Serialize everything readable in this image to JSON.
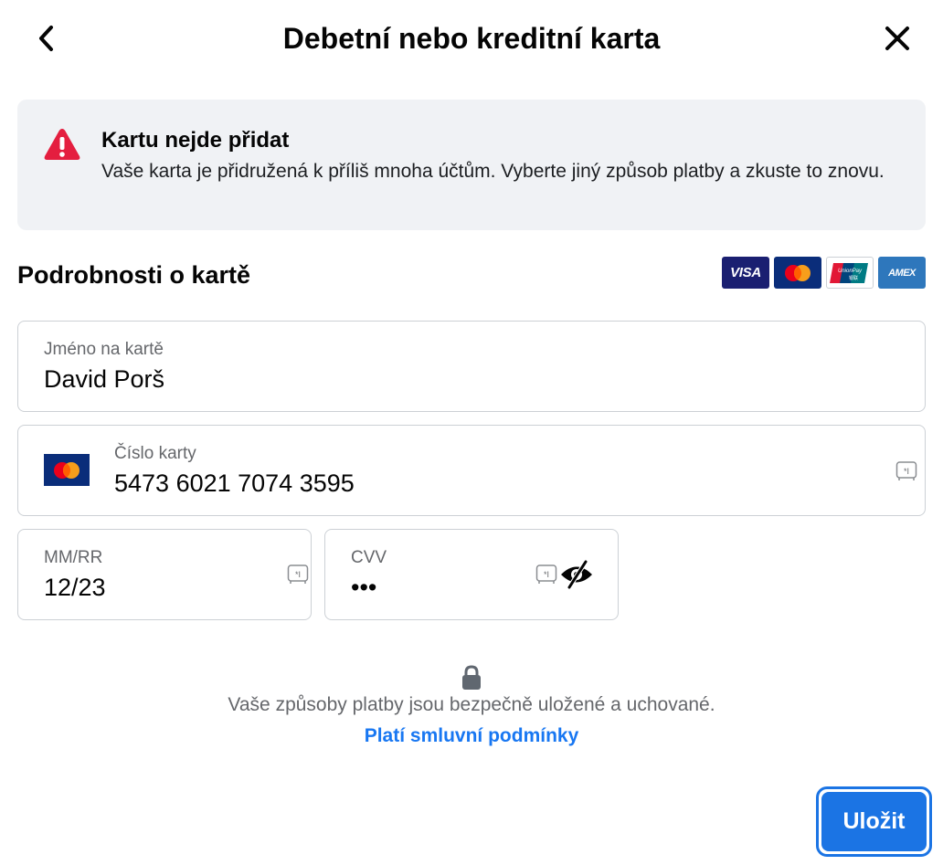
{
  "header": {
    "title": "Debetní nebo kreditní karta"
  },
  "alert": {
    "title": "Kartu nejde přidat",
    "message": "Vaše karta je přidružená k příliš mnoha účtům. Vyberte jiný způsob platby a zkuste to znovu.",
    "color": "#e41e3f"
  },
  "card_details": {
    "title": "Podrobnosti o kartě",
    "logos": [
      "VISA",
      "mastercard",
      "UnionPay",
      "AMEX"
    ]
  },
  "fields": {
    "name": {
      "label": "Jméno na kartě",
      "value": "David Porš"
    },
    "number": {
      "label": "Číslo karty",
      "value": "5473 6021 7074 3595"
    },
    "expiry": {
      "label": "MM/RR",
      "value": "12/23"
    },
    "cvv": {
      "label": "CVV",
      "value": "•••"
    }
  },
  "footer": {
    "secure_text": "Vaše způsoby platby jsou bezpečně uložené a uchované.",
    "terms_link": "Platí smluvní podmínky",
    "save_label": "Uložit"
  },
  "colors": {
    "accent": "#1b74e4",
    "link": "#1877f2",
    "alert_bg": "#f0f2f5"
  }
}
